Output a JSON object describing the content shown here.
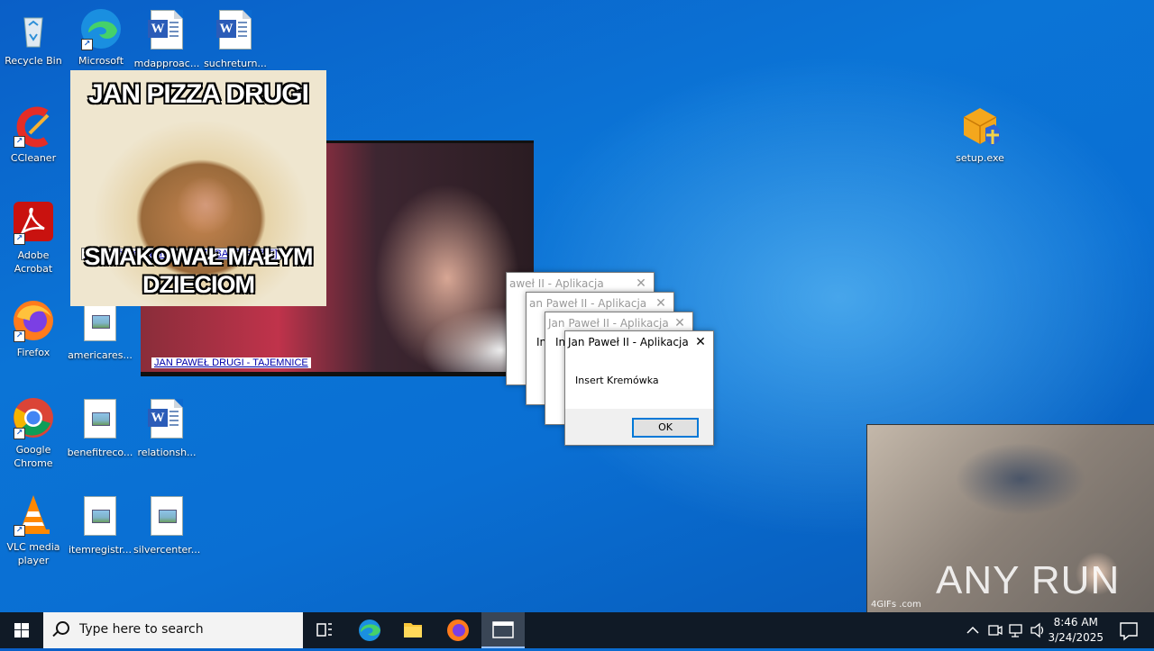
{
  "desktop": {
    "icons": [
      {
        "name": "recycle-bin",
        "label": "Recycle Bin"
      },
      {
        "name": "microsoft-edge",
        "label": "Microsoft Edge"
      },
      {
        "name": "mdapproach",
        "label": "mdapproac..."
      },
      {
        "name": "suchreturn",
        "label": "suchreturn..."
      },
      {
        "name": "ccleaner",
        "label": "CCleaner"
      },
      {
        "name": "adobe-acrobat",
        "label": "Adobe Acrobat"
      },
      {
        "name": "firefox",
        "label": "Firefox"
      },
      {
        "name": "americares",
        "label": "americares..."
      },
      {
        "name": "google-chrome",
        "label": "Google Chrome"
      },
      {
        "name": "benefitreco",
        "label": "benefitreco..."
      },
      {
        "name": "relationsh",
        "label": "relationsh..."
      },
      {
        "name": "vlc",
        "label": "VLC media player"
      },
      {
        "name": "itemregistr",
        "label": "itemregistr..."
      },
      {
        "name": "silvercenter",
        "label": "silvercenter..."
      },
      {
        "name": "setup-exe",
        "label": "setup.exe"
      }
    ]
  },
  "popups": {
    "pizza": {
      "title_top": "JAN PIZZA DRUGI",
      "title_bottom": "SMAKOWAŁ MAŁYM DZIECIOM",
      "link": "Watykańska gastronomia [ZOBACZ GDZIE]"
    },
    "video": {
      "link": "JAN PAWEŁ DRUGI - TAJEMNICE"
    },
    "bottom_video": {
      "watermark_gifs": "4GIFs .com",
      "watermark_anyrun": "ANY RUN"
    }
  },
  "dialogs": {
    "title": "Jan Paweł II - Aplikacja",
    "ghost_titles": [
      "aweł II - Aplikacja",
      "an Paweł II - Aplikacja",
      "Jan Paweł II - Aplikacja"
    ],
    "ghost_body": "In",
    "message": "Insert Kremówka",
    "ok_label": "OK"
  },
  "taskbar": {
    "search_placeholder": "Type here to search",
    "time": "8:46 AM",
    "date": "3/24/2025"
  }
}
